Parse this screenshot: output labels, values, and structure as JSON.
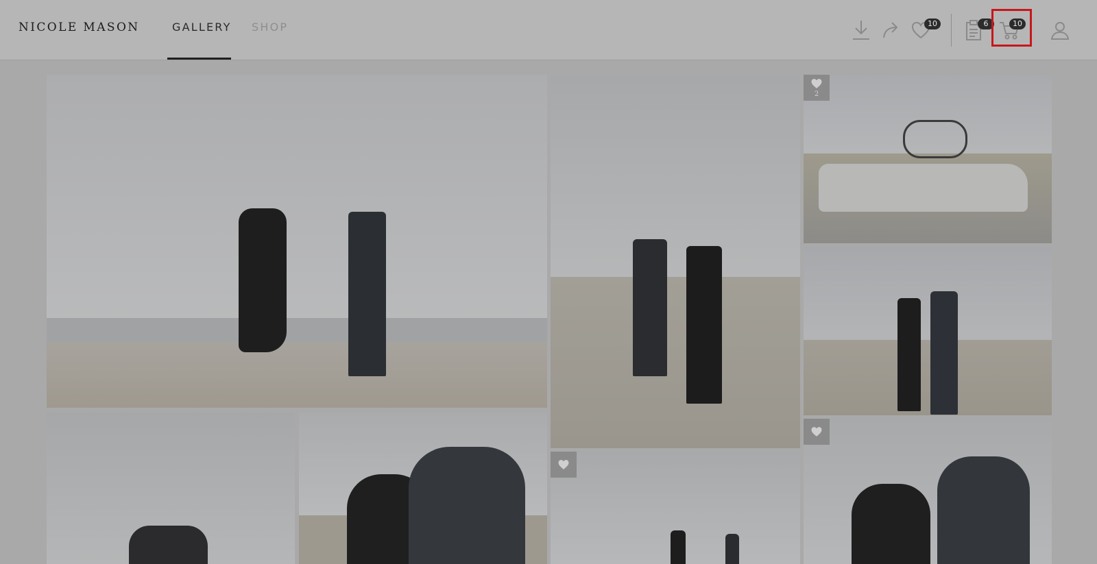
{
  "header": {
    "brand": "NICOLE MASON",
    "tabs": [
      {
        "label": "GALLERY",
        "active": true
      },
      {
        "label": "SHOP",
        "active": false
      }
    ],
    "icons": {
      "download": "download-icon",
      "share": "share-icon",
      "favorites": "heart-icon",
      "favorites_count": "10",
      "orders": "clipboard-icon",
      "orders_count": "6",
      "cart": "cart-icon",
      "cart_count": "10",
      "account": "user-icon"
    }
  },
  "gallery": {
    "photos": [
      {
        "subject": "couple-dunes-binoculars"
      },
      {
        "subject": "couple-standing-dunes"
      },
      {
        "subject": "car-with-bicycle",
        "favorite_count": "2"
      },
      {
        "subject": "couple-walking-dunes"
      },
      {
        "subject": "couple-portrait"
      },
      {
        "subject": "couple-closeup-binoculars"
      },
      {
        "subject": "running-on-beach"
      },
      {
        "subject": "portrait-binoculars"
      }
    ]
  },
  "colors": {
    "overlay": "#a9a9a9",
    "highlight": "#c8161c"
  }
}
